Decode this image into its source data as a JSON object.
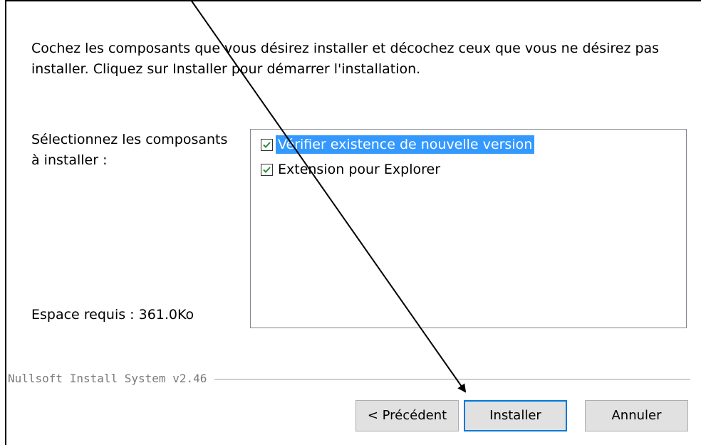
{
  "intro": {
    "text": "Cochez les composants que vous désirez installer et décochez ceux que vous ne désirez pas\ninstaller. Cliquez sur Installer pour démarrer l'installation."
  },
  "select_label": "Sélectionnez les composants\nà installer :",
  "components": [
    {
      "label": "Vérifier existence de nouvelle version",
      "checked": true,
      "selected": true
    },
    {
      "label": "Extension pour Explorer",
      "checked": true,
      "selected": false
    }
  ],
  "space_required": "Espace requis : 361.0Ko",
  "branding": "Nullsoft Install System v2.46",
  "buttons": {
    "back": "< Précédent",
    "install": "Installer",
    "cancel": "Annuler"
  },
  "colors": {
    "selection": "#3399ff",
    "checkmark": "#2e8b3a",
    "focus_border": "#0078d7",
    "annotation_arrow": "#000000"
  },
  "icons": {
    "checkbox": "checkbox-checked-icon",
    "annotation": "annotation-arrow-icon"
  }
}
